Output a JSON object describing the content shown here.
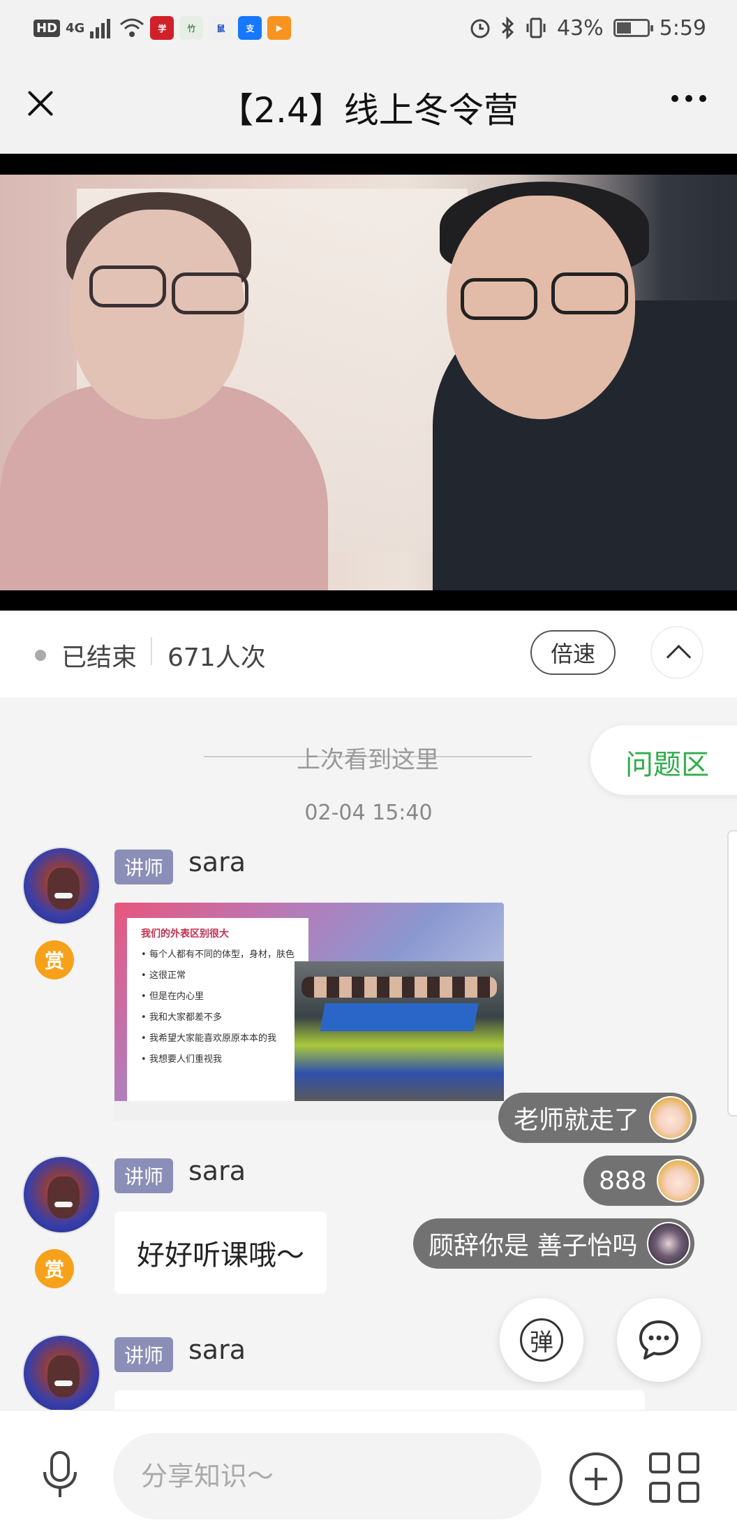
{
  "status_bar": {
    "hd": "HD",
    "network": "4G",
    "battery": "43%",
    "time": "5:59",
    "icons": [
      "hd-icon",
      "signal-icon",
      "wifi-icon",
      "app-icon-red",
      "app-icon-green",
      "app-icon-blue",
      "app-icon-alipay",
      "app-icon-orange",
      "alarm-icon",
      "bluetooth-icon",
      "vibrate-icon",
      "battery-icon"
    ]
  },
  "nav": {
    "title": "【2.4】线上冬令营",
    "close_icon": "close-icon",
    "more_icon": "more-icon"
  },
  "info": {
    "status": "已结束",
    "views": "671人次",
    "speed_label": "倍速"
  },
  "chat": {
    "last_seen_label": "上次看到这里",
    "timestamp": "02-04 15:40",
    "qa_tab_label": "问题区",
    "messages": [
      {
        "role": "讲师",
        "sender": "sara",
        "reward": "赏",
        "type": "image",
        "slide": {
          "heading": "我们的外表区别很大",
          "bullets": [
            "每个人都有不同的体型，身材，肤色",
            "这很正常",
            "但是在内心里",
            "我和大家都差不多",
            "我希望大家能喜欢原原本本的我",
            "我想要人们重视我"
          ]
        }
      },
      {
        "role": "讲师",
        "sender": "sara",
        "reward": "赏",
        "type": "text",
        "text": "好好听课哦～"
      },
      {
        "role": "讲师",
        "sender": "sara",
        "type": "text",
        "text": ""
      }
    ],
    "danmaku": [
      {
        "text": "老师就走了"
      },
      {
        "text": "888"
      },
      {
        "text": "顾辞你是 善子怡吗"
      }
    ],
    "danmu_button": "弹"
  },
  "input": {
    "placeholder": "分享知识～"
  }
}
